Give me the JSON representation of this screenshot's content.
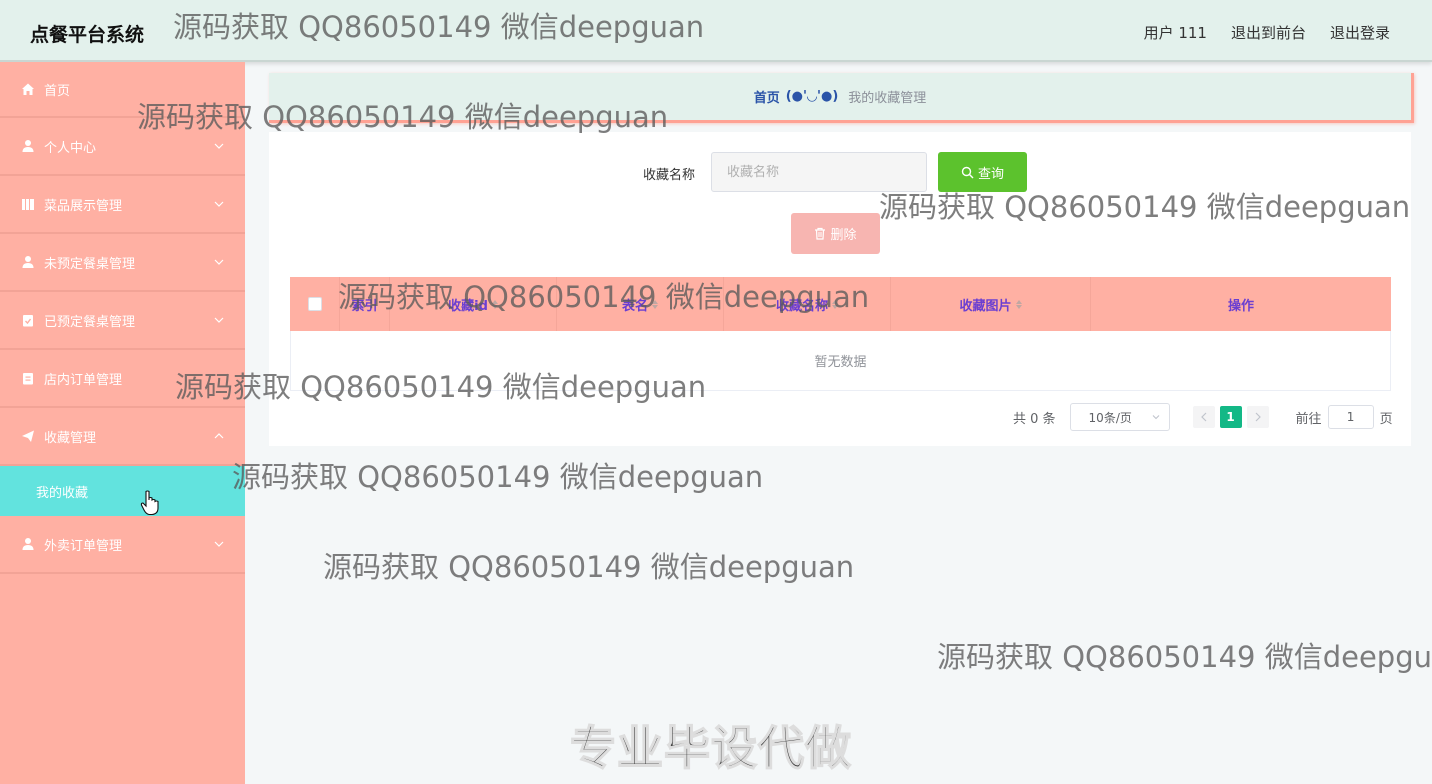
{
  "header": {
    "brand": "点餐平台系统",
    "user": "用户 111",
    "to_front": "退出到前台",
    "logout": "退出登录"
  },
  "sidebar": {
    "items": [
      {
        "label": "首页",
        "icon": "home-icon",
        "has_arrow": false
      },
      {
        "label": "个人中心",
        "icon": "user-icon",
        "has_arrow": true
      },
      {
        "label": "菜品展示管理",
        "icon": "book-icon",
        "has_arrow": true
      },
      {
        "label": "未预定餐桌管理",
        "icon": "user-icon",
        "has_arrow": true
      },
      {
        "label": "已预定餐桌管理",
        "icon": "clipboard-check-icon",
        "has_arrow": true
      },
      {
        "label": "店内订单管理",
        "icon": "clipboard-icon",
        "has_arrow": false
      },
      {
        "label": "收藏管理",
        "icon": "paper-plane-icon",
        "has_arrow": true,
        "expanded": true
      },
      {
        "label": "外卖订单管理",
        "icon": "user-icon",
        "has_arrow": true
      }
    ],
    "submenu": {
      "label": "我的收藏"
    }
  },
  "breadcrumb": {
    "home": "首页",
    "separator": "(●'◡'●)",
    "current": "我的收藏管理"
  },
  "search": {
    "label": "收藏名称",
    "placeholder": "收藏名称",
    "query_button": "查询",
    "delete_button": "删除"
  },
  "table": {
    "columns": [
      "索引",
      "收藏id",
      "表名",
      "收藏名称",
      "收藏图片",
      "操作"
    ],
    "empty_text": "暂无数据"
  },
  "pagination": {
    "total": "共 0 条",
    "page_size": "10条/页",
    "current_page": "1",
    "goto_label": "前往",
    "goto_value": "1",
    "page_suffix": "页"
  },
  "watermark": {
    "text": "源码获取 QQ86050149 微信deepguan",
    "text_cut": "源码获取 QQ86050149 微信deepgu",
    "promo": "专业毕设代做"
  },
  "colors": {
    "sidebar_bg": "#ffb0a3",
    "header_bg": "#e3f1ec",
    "active_sub": "#62e3de",
    "query_btn": "#5cc22d",
    "delete_btn": "#f7b5b1",
    "pager_active": "#13b886"
  }
}
